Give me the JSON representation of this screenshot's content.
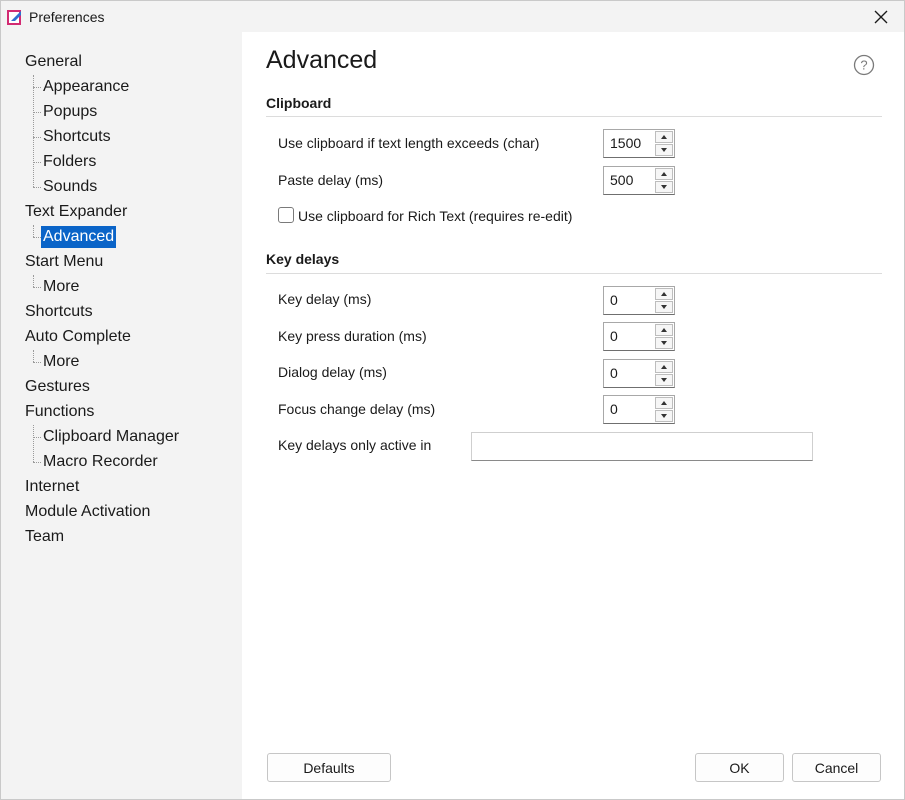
{
  "window": {
    "title": "Preferences",
    "accent_color": "#0a64c8",
    "app_icon": "app-logo-icon",
    "close_icon": "close-icon"
  },
  "sidebar": {
    "items": [
      {
        "label": "General",
        "level": 0
      },
      {
        "label": "Appearance",
        "level": 1
      },
      {
        "label": "Popups",
        "level": 1
      },
      {
        "label": "Shortcuts",
        "level": 1
      },
      {
        "label": "Folders",
        "level": 1
      },
      {
        "label": "Sounds",
        "level": 1
      },
      {
        "label": "Text Expander",
        "level": 0
      },
      {
        "label": "Advanced",
        "level": 1,
        "selected": true
      },
      {
        "label": "Start Menu",
        "level": 0
      },
      {
        "label": "More",
        "level": 1
      },
      {
        "label": "Shortcuts",
        "level": 0
      },
      {
        "label": "Auto Complete",
        "level": 0
      },
      {
        "label": "More",
        "level": 1
      },
      {
        "label": "Gestures",
        "level": 0
      },
      {
        "label": "Functions",
        "level": 0
      },
      {
        "label": "Clipboard Manager",
        "level": 1
      },
      {
        "label": "Macro Recorder",
        "level": 1
      },
      {
        "label": "Internet",
        "level": 0
      },
      {
        "label": "Module Activation",
        "level": 0
      },
      {
        "label": "Team",
        "level": 0
      }
    ]
  },
  "main": {
    "title": "Advanced",
    "help_icon": "help-icon",
    "clipboard": {
      "heading": "Clipboard",
      "threshold_label": "Use clipboard if text length exceeds (char)",
      "threshold_value": "1500",
      "paste_delay_label": "Paste delay (ms)",
      "paste_delay_value": "500",
      "rich_text_label": "Use clipboard for Rich Text (requires re-edit)",
      "rich_text_checked": false
    },
    "key_delays": {
      "heading": "Key delays",
      "key_delay_label": "Key delay (ms)",
      "key_delay_value": "0",
      "key_press_label": "Key press duration (ms)",
      "key_press_value": "0",
      "dialog_delay_label": "Dialog delay (ms)",
      "dialog_delay_value": "0",
      "focus_change_label": "Focus change delay (ms)",
      "focus_change_value": "0",
      "active_in_label": "Key delays only active in",
      "active_in_value": ""
    }
  },
  "footer": {
    "defaults_label": "Defaults",
    "ok_label": "OK",
    "cancel_label": "Cancel"
  }
}
